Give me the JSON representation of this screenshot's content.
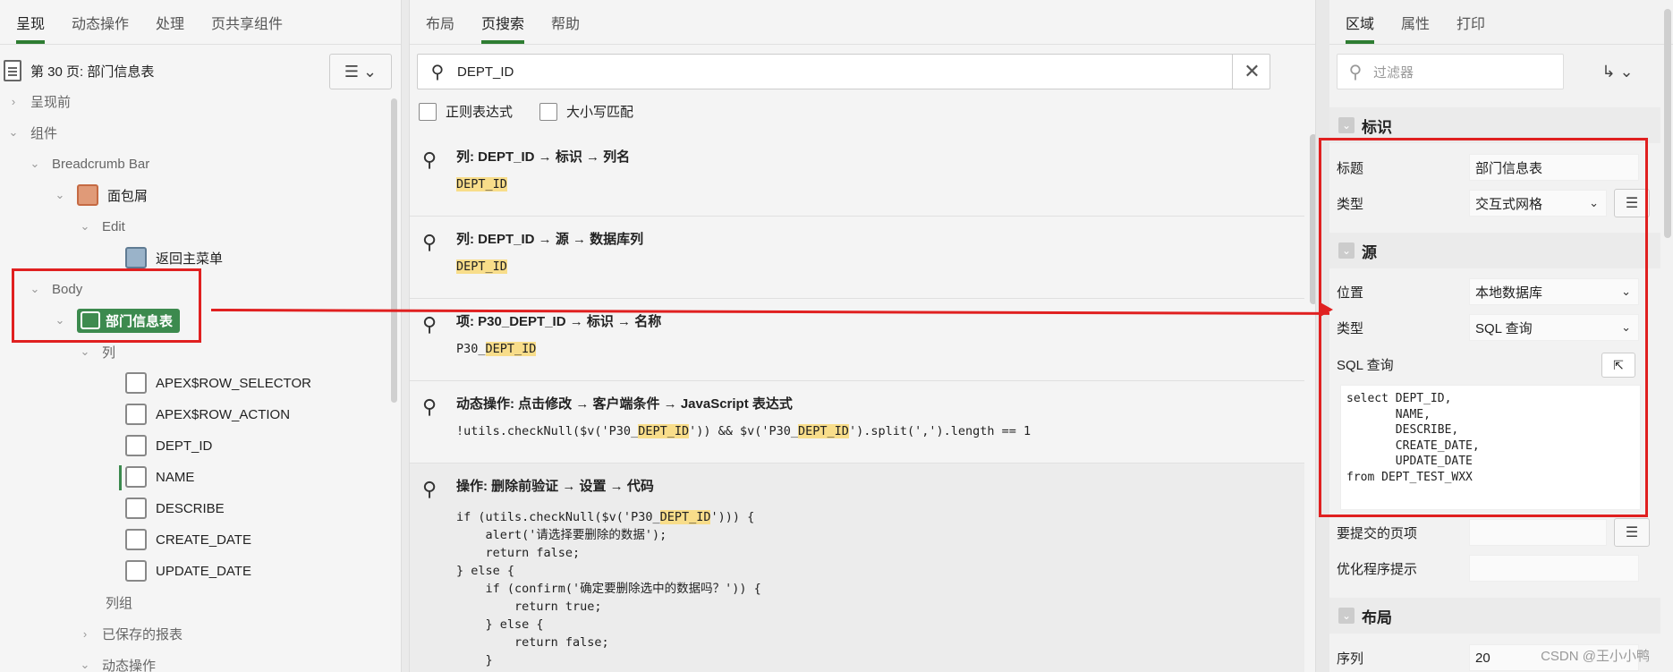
{
  "left": {
    "tabs": [
      "呈现",
      "动态操作",
      "处理",
      "页共享组件"
    ],
    "page_title": "第 30 页: 部门信息表",
    "tree": {
      "before_render": "呈现前",
      "components": "组件",
      "breadcrumb_bar": "Breadcrumb Bar",
      "breadcrumb": "面包屑",
      "edit": "Edit",
      "back_menu": "返回主菜单",
      "body": "Body",
      "region": "部门信息表",
      "columns": "列",
      "col_items": [
        "APEX$ROW_SELECTOR",
        "APEX$ROW_ACTION",
        "DEPT_ID",
        "NAME",
        "DESCRIBE",
        "CREATE_DATE",
        "UPDATE_DATE"
      ],
      "column_groups": "列组",
      "saved_reports": "已保存的报表",
      "dynamic_actions": "动态操作"
    }
  },
  "mid": {
    "tabs": [
      "布局",
      "页搜索",
      "帮助"
    ],
    "search_value": "DEPT_ID",
    "regex_label": "正则表达式",
    "case_label": "大小写匹配",
    "results": [
      {
        "title": "列: DEPT_ID → 标识 → 列名",
        "pre": "",
        "hl": "DEPT_ID",
        "post": ""
      },
      {
        "title": "列: DEPT_ID → 源 → 数据库列",
        "pre": "",
        "hl": "DEPT_ID",
        "post": ""
      },
      {
        "title": "项: P30_DEPT_ID → 标识 → 名称",
        "pre": "P30_",
        "hl": "DEPT_ID",
        "post": ""
      },
      {
        "title": "动态操作: 点击修改 → 客户端条件 → JavaScript 表达式",
        "pre": "!utils.checkNull($v('P30_",
        "hl": "DEPT_ID",
        "mid": "')) && $v('P30_",
        "hl2": "DEPT_ID",
        "post": "').split(',').length == 1"
      },
      {
        "title": "操作: 删除前验证 → 设置 → 代码",
        "code_pre": "if (utils.checkNull($v('P30_",
        "code_hl": "DEPT_ID",
        "code_post": "'))) {",
        "code_rest": "    alert('请选择要删除的数据');\n    return false;\n} else {\n    if (confirm('确定要删除选中的数据吗？')) {\n        return true;\n    } else {\n        return false;\n    }\n}"
      }
    ]
  },
  "right": {
    "tabs": [
      "区域",
      "属性",
      "打印"
    ],
    "filter_placeholder": "过滤器",
    "identification": {
      "header": "标识",
      "title_label": "标题",
      "title_value": "部门信息表",
      "type_label": "类型",
      "type_value": "交互式网格"
    },
    "source": {
      "header": "源",
      "location_label": "位置",
      "location_value": "本地数据库",
      "type_label": "类型",
      "type_value": "SQL 查询",
      "sql_label": "SQL 查询",
      "sql_value": "select DEPT_ID,\n       NAME,\n       DESCRIBE,\n       CREATE_DATE,\n       UPDATE_DATE\nfrom DEPT_TEST_WXX",
      "submit_label": "要提交的页项",
      "optimizer_label": "优化程序提示"
    },
    "layout": {
      "header": "布局",
      "seq_label": "序列",
      "seq_value": "20"
    }
  },
  "watermark": "CSDN @王小小鸭",
  "colors": {
    "accent": "#2e7d32",
    "highlight": "#f8dd8a",
    "annotation": "#e02020"
  }
}
